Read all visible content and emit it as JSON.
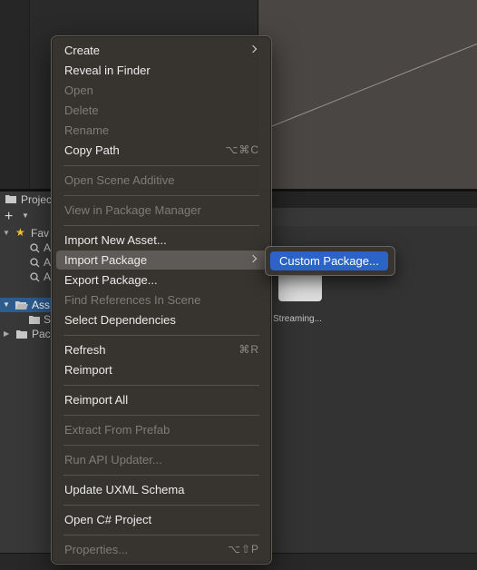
{
  "project_panel": {
    "tab_label": "Projec",
    "add_label": "+",
    "tree": [
      {
        "label": "Fav",
        "kind": "favorites"
      },
      {
        "label": "A",
        "kind": "search"
      },
      {
        "label": "A",
        "kind": "search"
      },
      {
        "label": "A",
        "kind": "search"
      },
      {
        "label": "Ass",
        "kind": "folder-open",
        "selected": true
      },
      {
        "label": "S",
        "kind": "folder"
      },
      {
        "label": "Pac",
        "kind": "folder"
      }
    ],
    "asset_label": "Streaming..."
  },
  "context_menu": {
    "items": [
      {
        "label": "Create",
        "enabled": true,
        "submenu": true
      },
      {
        "label": "Reveal in Finder",
        "enabled": true
      },
      {
        "label": "Open",
        "enabled": false
      },
      {
        "label": "Delete",
        "enabled": false
      },
      {
        "label": "Rename",
        "enabled": false
      },
      {
        "label": "Copy Path",
        "enabled": true,
        "shortcut": "⌥⌘C"
      },
      {
        "label": "Open Scene Additive",
        "enabled": false
      },
      {
        "label": "View in Package Manager",
        "enabled": false
      },
      {
        "label": "Import New Asset...",
        "enabled": true
      },
      {
        "label": "Import Package",
        "enabled": true,
        "submenu": true,
        "highlighted": true
      },
      {
        "label": "Export Package...",
        "enabled": true
      },
      {
        "label": "Find References In Scene",
        "enabled": false
      },
      {
        "label": "Select Dependencies",
        "enabled": true
      },
      {
        "label": "Refresh",
        "enabled": true,
        "shortcut": "⌘R"
      },
      {
        "label": "Reimport",
        "enabled": true
      },
      {
        "label": "Reimport All",
        "enabled": true
      },
      {
        "label": "Extract From Prefab",
        "enabled": false
      },
      {
        "label": "Run API Updater...",
        "enabled": false
      },
      {
        "label": "Update UXML Schema",
        "enabled": true
      },
      {
        "label": "Open C# Project",
        "enabled": true
      },
      {
        "label": "Properties...",
        "enabled": false,
        "shortcut": "⌥⇧P"
      }
    ]
  },
  "submenu": {
    "items": [
      {
        "label": "Custom Package...",
        "selected": true
      }
    ]
  },
  "colors": {
    "accent": "#2a64c6",
    "selection": "#2d5c8f",
    "menu_bg": "#383430",
    "scene_bg": "#4a4644"
  }
}
